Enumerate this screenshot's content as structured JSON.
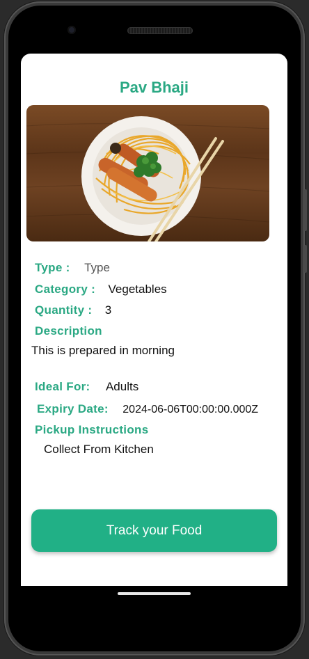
{
  "dish": {
    "name": "Pav Bhaji"
  },
  "details": {
    "type_label": "Type :",
    "type_value": "Type",
    "category_label": "Category :",
    "category_value": "Vegetables",
    "quantity_label": "Quantity :",
    "quantity_value": "3",
    "description_label": "Description",
    "description_value": "This is prepared in morning",
    "ideal_label": "Ideal For:",
    "ideal_value": "Adults",
    "expiry_label": "Expiry Date:",
    "expiry_value": "2024-06-06T00:00:00.000Z",
    "pickup_label": "Pickup Instructions",
    "pickup_value": "Collect From Kitchen"
  },
  "actions": {
    "track_label": "Track your Food"
  },
  "colors": {
    "accent": "#2aa883",
    "button": "#21b086"
  }
}
